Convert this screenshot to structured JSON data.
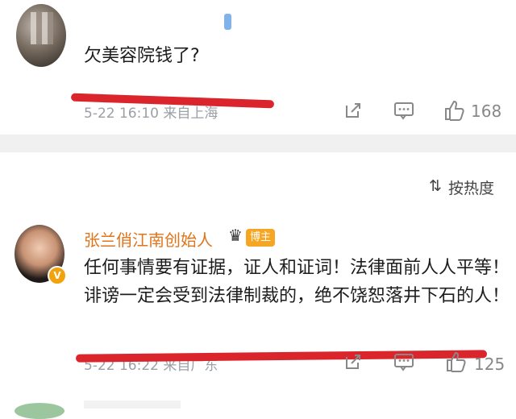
{
  "comment1": {
    "text": "欠美容院钱了?",
    "meta": "5-22 16:10 来自上海",
    "like_count": "168",
    "icons": {
      "share": "share-icon",
      "comment": "comment-icon",
      "like": "like-icon"
    }
  },
  "sort": {
    "label": "按热度",
    "icon": "sort-icon"
  },
  "comment2": {
    "username": "张兰俏江南创始人",
    "badge": "博主",
    "verified": "V",
    "text": "任何事情要有证据，证人和证词！法律面前人人平等！诽谤一定会受到法律制裁的，绝不饶恕落井下石的人！",
    "meta": "5-22 16:22 来自广东",
    "like_count": "125",
    "icons": {
      "share": "share-icon",
      "comment": "comment-icon",
      "like": "like-icon"
    }
  },
  "colors": {
    "annotation_red": "#d9252b",
    "username_orange": "#e0741b",
    "badge_orange": "#f5a623"
  }
}
